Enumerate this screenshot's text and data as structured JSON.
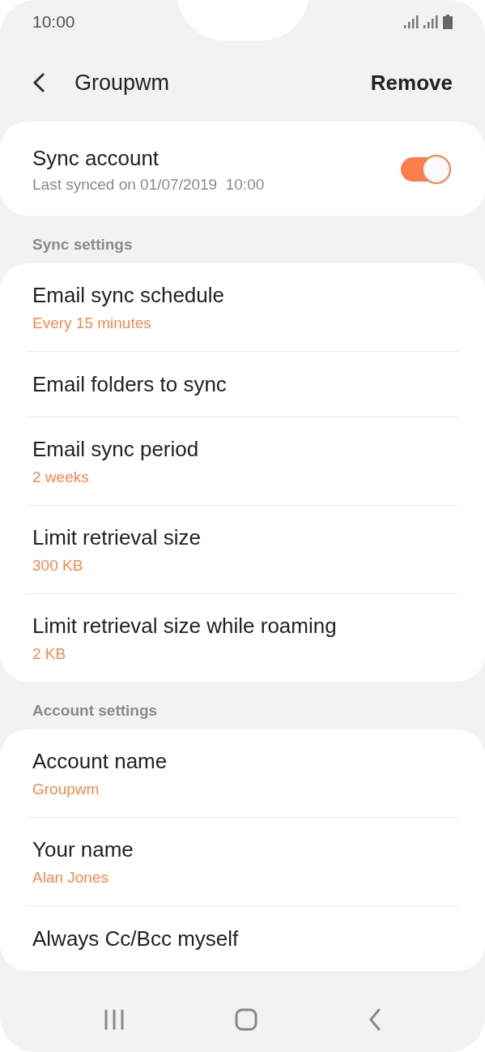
{
  "status_bar": {
    "time": "10:00"
  },
  "header": {
    "title": "Groupwm",
    "action": "Remove"
  },
  "sync_account": {
    "title": "Sync account",
    "subtitle": "Last synced on 01/07/2019  10:00",
    "on": true
  },
  "sections": [
    {
      "title": "Sync settings",
      "items": [
        {
          "title": "Email sync schedule",
          "value": "Every 15 minutes"
        },
        {
          "title": "Email folders to sync"
        },
        {
          "title": "Email sync period",
          "value": "2 weeks"
        },
        {
          "title": "Limit retrieval size",
          "value": "300 KB"
        },
        {
          "title": "Limit retrieval size while roaming",
          "value": "2 KB"
        }
      ]
    },
    {
      "title": "Account settings",
      "items": [
        {
          "title": "Account name",
          "value": "Groupwm"
        },
        {
          "title": "Your name",
          "value": "Alan Jones"
        },
        {
          "title": "Always Cc/Bcc myself"
        }
      ]
    }
  ]
}
